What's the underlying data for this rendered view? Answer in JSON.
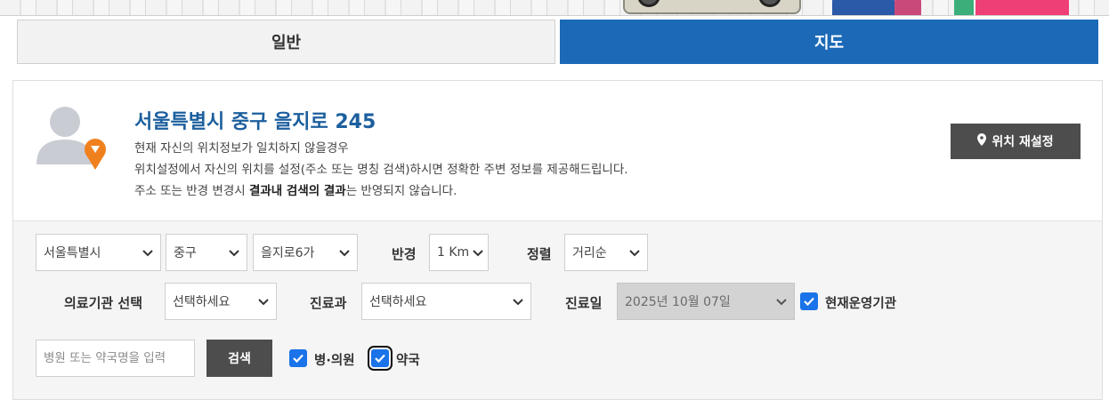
{
  "tabs": {
    "general_label": "일반",
    "map_label": "지도"
  },
  "location": {
    "address": "서울특별시 중구 을지로 245",
    "desc_line1": "현재 자신의 위치정보가 일치하지 않을경우",
    "desc_line2": "위치설정에서 자신의 위치를 설정(주소 또는 명칭 검색)하시면 정확한 주변 정보를 제공해드립니다.",
    "desc_line3_prefix": "주소 또는 반경 변경시 ",
    "desc_line3_bold": "결과내 검색의 결과",
    "desc_line3_suffix": "는 반영되지 않습니다.",
    "reset_button": "위치 재설정",
    "reset_icon": "map-pin-icon",
    "avatar_icon": "user-location-avatar"
  },
  "filters": {
    "city": "서울특별시",
    "district": "중구",
    "neighborhood": "을지로6가",
    "radius_label": "반경",
    "radius": "1 Km",
    "sort_label": "정렬",
    "sort": "거리순",
    "institution_label": "의료기관 선택",
    "institution": "선택하세요",
    "department_label": "진료과",
    "department": "선택하세요",
    "date_label": "진료일",
    "date": "2025년 10월 07일",
    "open_now_label": "현재운영기관",
    "open_now_checked": true
  },
  "search": {
    "placeholder": "병원 또는 약국명을 입력",
    "button": "검색",
    "hospital_label": "병·의원",
    "hospital_checked": true,
    "pharmacy_label": "약국",
    "pharmacy_checked": true
  },
  "colors": {
    "primary": "#1c6ab7",
    "address": "#1c5f9e",
    "dark_button": "#4d4d4d",
    "checkbox": "#1a73e8",
    "pin": "#f0801e"
  }
}
